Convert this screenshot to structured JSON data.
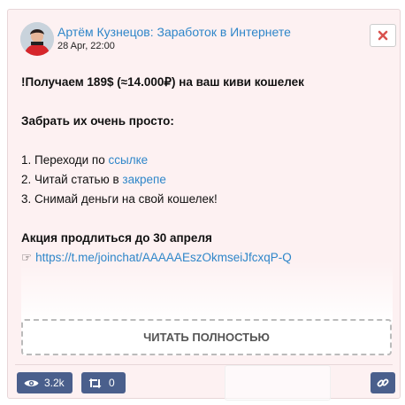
{
  "post": {
    "author": "Артём Кузнецов: Заработок в Интернете",
    "date": "28 Apr, 22:00",
    "content": {
      "headline": "!Получаем 189$ (≈14.000₽) на ваш киви кошелек",
      "intro": "Забрать их очень просто:",
      "step1_prefix": "1. Переходи по ",
      "step1_link": "ссылке",
      "step2_prefix": "2. Читай статью в ",
      "step2_link": "закрепе",
      "step3": "3. Снимай деньги на свой кошелек!",
      "promo": "Акция продлиться до 30 апреля",
      "link_icon": "☞",
      "link": "https://t.me/joinchat/AAAAAEszOkmseiJfcxqP-Q"
    },
    "read_more": "ЧИТАТЬ ПОЛНОСТЬЮ"
  },
  "footer": {
    "views": "3.2k",
    "reposts": "0"
  },
  "icons": {
    "close": "close-icon",
    "views": "eye-icon",
    "reposts": "retweet-icon",
    "share": "link-icon"
  },
  "colors": {
    "card_background": "#fdf1f2",
    "link": "#2e86c9",
    "button": "#4a5f8c",
    "close": "#d9534f"
  }
}
